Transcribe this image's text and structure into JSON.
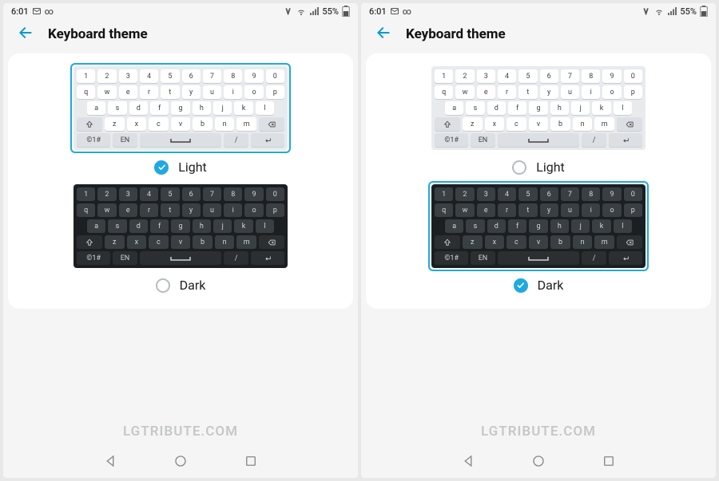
{
  "status": {
    "time": "6:01",
    "battery_text": "55%"
  },
  "header": {
    "title": "Keyboard theme"
  },
  "themes": {
    "light_label": "Light",
    "dark_label": "Dark"
  },
  "keyboard": {
    "row1": [
      "1",
      "2",
      "3",
      "4",
      "5",
      "6",
      "7",
      "8",
      "9",
      "0"
    ],
    "row2": [
      "q",
      "w",
      "e",
      "r",
      "t",
      "y",
      "u",
      "i",
      "o",
      "p"
    ],
    "row3": [
      "a",
      "s",
      "d",
      "f",
      "g",
      "h",
      "j",
      "k",
      "l"
    ],
    "row4_mid": [
      "z",
      "x",
      "c",
      "v",
      "b",
      "n",
      "m"
    ],
    "row5": {
      "sym": "©1#",
      "lang": "EN",
      "slash": "/"
    },
    "space_glyph": "⎵"
  },
  "watermark": "LGTRIBUTE.COM",
  "screens": [
    {
      "selected": "light"
    },
    {
      "selected": "dark"
    }
  ]
}
